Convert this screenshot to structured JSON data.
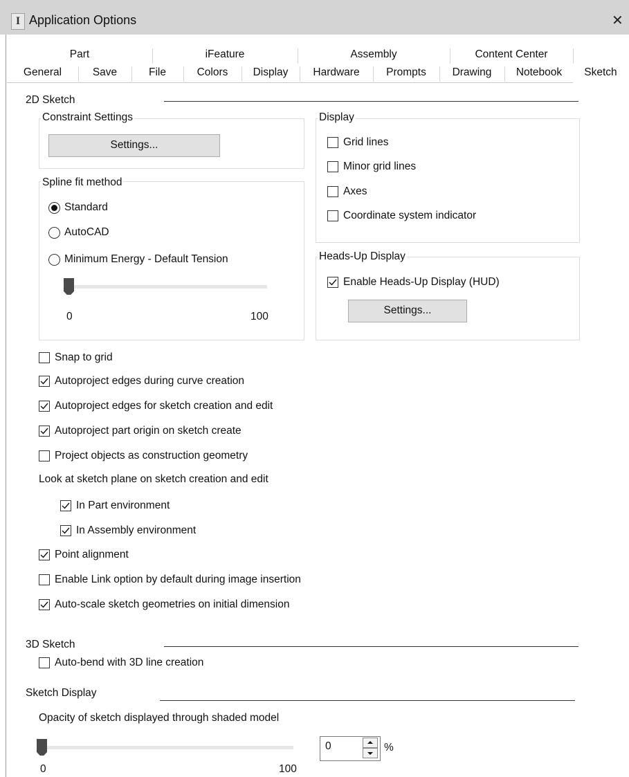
{
  "window": {
    "title": "Application Options",
    "close_glyph": "✕",
    "app_icon_glyph": "I"
  },
  "tabs_row1": [
    "Part",
    "iFeature",
    "Assembly",
    "Content Center"
  ],
  "tabs_row2": [
    "General",
    "Save",
    "File",
    "Colors",
    "Display",
    "Hardware",
    "Prompts",
    "Drawing",
    "Notebook",
    "Sketch"
  ],
  "active_tab": "Sketch",
  "sketch2d": {
    "heading": "2D Sketch",
    "constraint": {
      "label": "Constraint Settings",
      "button": "Settings..."
    },
    "spline": {
      "label": "Spline fit method",
      "options": [
        "Standard",
        "AutoCAD",
        "Minimum Energy - Default Tension"
      ],
      "selected": "Standard",
      "slider_min": "0",
      "slider_max": "100",
      "slider_value": 0
    },
    "display": {
      "label": "Display",
      "items": [
        {
          "label": "Grid lines",
          "checked": false
        },
        {
          "label": "Minor grid lines",
          "checked": false
        },
        {
          "label": "Axes",
          "checked": false
        },
        {
          "label": "Coordinate system indicator",
          "checked": false
        }
      ]
    },
    "hud": {
      "label": "Heads-Up Display",
      "enable_label": "Enable Heads-Up Display (HUD)",
      "enable_checked": true,
      "button": "Settings..."
    },
    "options": [
      {
        "label": "Snap to grid",
        "checked": false
      },
      {
        "label": "Autoproject edges during curve creation",
        "checked": true
      },
      {
        "label": "Autoproject edges for sketch creation and edit",
        "checked": true
      },
      {
        "label": "Autoproject part origin on sketch create",
        "checked": true
      },
      {
        "label": "Project objects as construction geometry",
        "checked": false
      }
    ],
    "look_at": {
      "label": "Look at sketch plane on sketch creation and edit",
      "items": [
        {
          "label": "In Part environment",
          "checked": true
        },
        {
          "label": "In Assembly environment",
          "checked": true
        }
      ]
    },
    "options2": [
      {
        "label": "Point alignment",
        "checked": true
      },
      {
        "label": "Enable Link option by default during image insertion",
        "checked": false
      },
      {
        "label": "Auto-scale sketch geometries on initial dimension",
        "checked": true
      }
    ]
  },
  "sketch3d": {
    "heading": "3D Sketch",
    "autobend": {
      "label": "Auto-bend with 3D line creation",
      "checked": false
    }
  },
  "sketch_display": {
    "heading": "Sketch Display",
    "opacity_label": "Opacity of sketch displayed through shaded model",
    "slider_min": "0",
    "slider_max": "100",
    "slider_value": 0,
    "spin_value": "0",
    "unit": "%"
  },
  "colors": {
    "titlebar": "#d4d4d4",
    "button": "#e1e1e1",
    "thumb": "#4a4a4a"
  }
}
